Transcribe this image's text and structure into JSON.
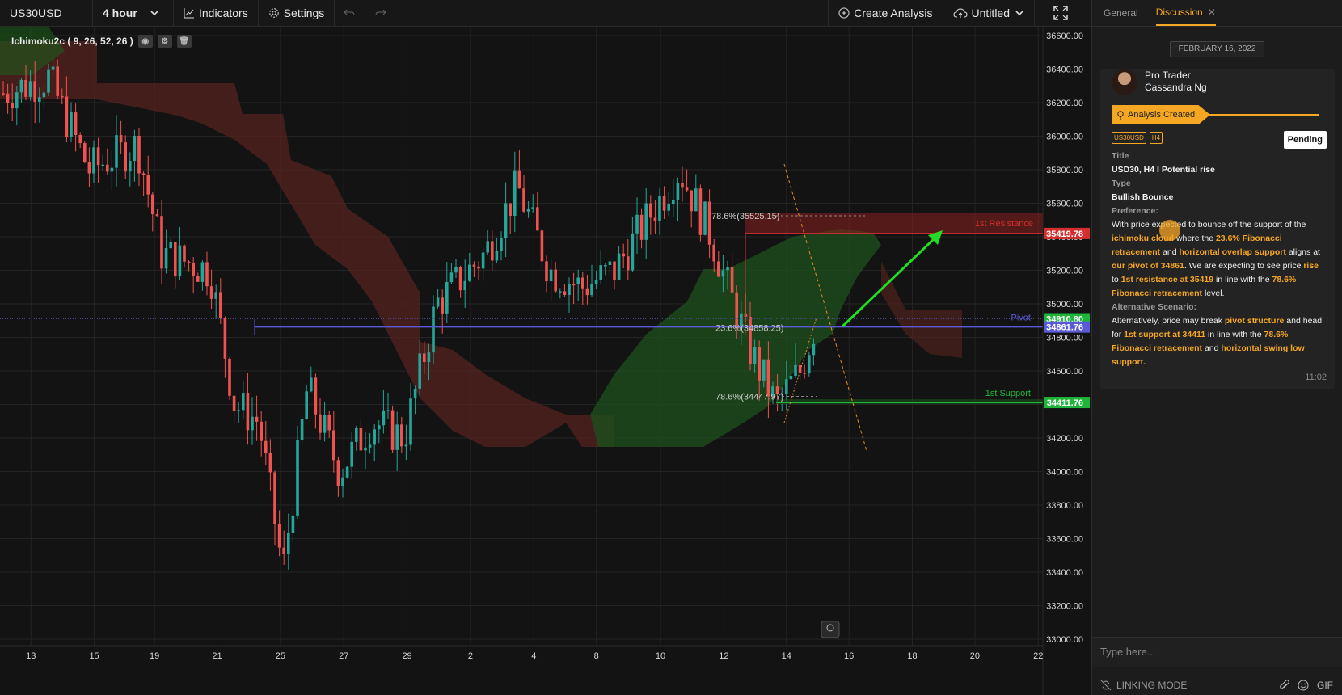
{
  "toolbar": {
    "symbol": "US30USD",
    "interval": "4 hour",
    "indicators_label": "Indicators",
    "settings_label": "Settings",
    "create_analysis_label": "Create Analysis",
    "layout_name": "Untitled"
  },
  "indicator": {
    "label": "Ichimoku2c ( 9, 26, 52, 26 )"
  },
  "chart_data": {
    "type": "candlestick",
    "x_ticks": [
      "13",
      "15",
      "19",
      "21",
      "25",
      "27",
      "29",
      "2",
      "4",
      "8",
      "10",
      "12",
      "14",
      "16",
      "18",
      "20",
      "22"
    ],
    "y_ticks": [
      "36600.00",
      "36400.00",
      "36200.00",
      "36000.00",
      "35800.00",
      "35600.00",
      "35400.00",
      "35200.00",
      "35000.00",
      "34800.00",
      "34600.00",
      "34400.00",
      "34200.00",
      "34000.00",
      "33800.00",
      "33600.00",
      "33400.00",
      "33200.00",
      "33000.00"
    ],
    "ylim": [
      33000,
      36600
    ],
    "levels": {
      "resistance": {
        "label": "1st Resistance",
        "price": "35419.78",
        "value": 35419.78,
        "color": "#d32f2f"
      },
      "pivot": {
        "label": "Pivot",
        "price": "34861.76",
        "value": 34861.76,
        "color": "#5a5ad6"
      },
      "support": {
        "label": "1st Support",
        "price": "34411.76",
        "value": 34411.76,
        "color": "#1fb53b"
      },
      "last_price": {
        "price": "34910.80",
        "value": 34910.8
      }
    },
    "fib_labels": {
      "fib1": "78.6%(35525.15)",
      "fib2": "23.6%(34858.25)",
      "fib3": "78.6%(34447.97)"
    },
    "fib_values": {
      "fib1": 35525.15,
      "fib2": 34858.25,
      "fib3": 34447.97
    },
    "bullish_color": "#26a69a",
    "bearish_color": "#ef5350",
    "cloud_bull_color": "#1d4d1d",
    "cloud_bear_color": "#5a2420"
  },
  "sidebar": {
    "tabs": {
      "general": "General",
      "discussion": "Discussion"
    },
    "date": "FEBRUARY 16, 2022",
    "card": {
      "author_line1": "Pro Trader",
      "author_line2": "Cassandra Ng",
      "banner": "Analysis Created",
      "tag_symbol": "US30USD",
      "tag_tf": "H4",
      "status": "Pending",
      "title_label": "Title",
      "title_value": "USD30, H4 I Potential rise",
      "type_label": "Type",
      "type_value": "Bullish Bounce",
      "pref_label": "Preference:",
      "pref": {
        "t1": "With price expected to bounce off the support of the ",
        "h1": "ichimoku cloud",
        "t2": " where the ",
        "h2": "23.6% Fibonacci retracement",
        "t3": " and ",
        "h3": "horizontal overlap support",
        "t4": " aligns at ",
        "h4": "our pivot of 34861",
        "t5": ". We are expecting to see price ",
        "h5": "rise",
        "t6": " to ",
        "h6": "1st resistance at 35419",
        "t7": " in line with the ",
        "h7": "78.6% Fibonacci retracement",
        "t8": " level."
      },
      "alt_label": "Alternative Scenario:",
      "alt": {
        "t1": "Alternatively, price may break ",
        "h1": "pivot structure",
        "t2": " and head for ",
        "h2": "1st support at 34411",
        "t3": " in line with the ",
        "h3": "78.6% Fibonacci retracement",
        "t4": " and ",
        "h4": "horizontal swing low support."
      },
      "time": "11:02"
    },
    "input_placeholder": "Type here...",
    "linking_label": "LINKING MODE",
    "gif_label": "GIF"
  }
}
